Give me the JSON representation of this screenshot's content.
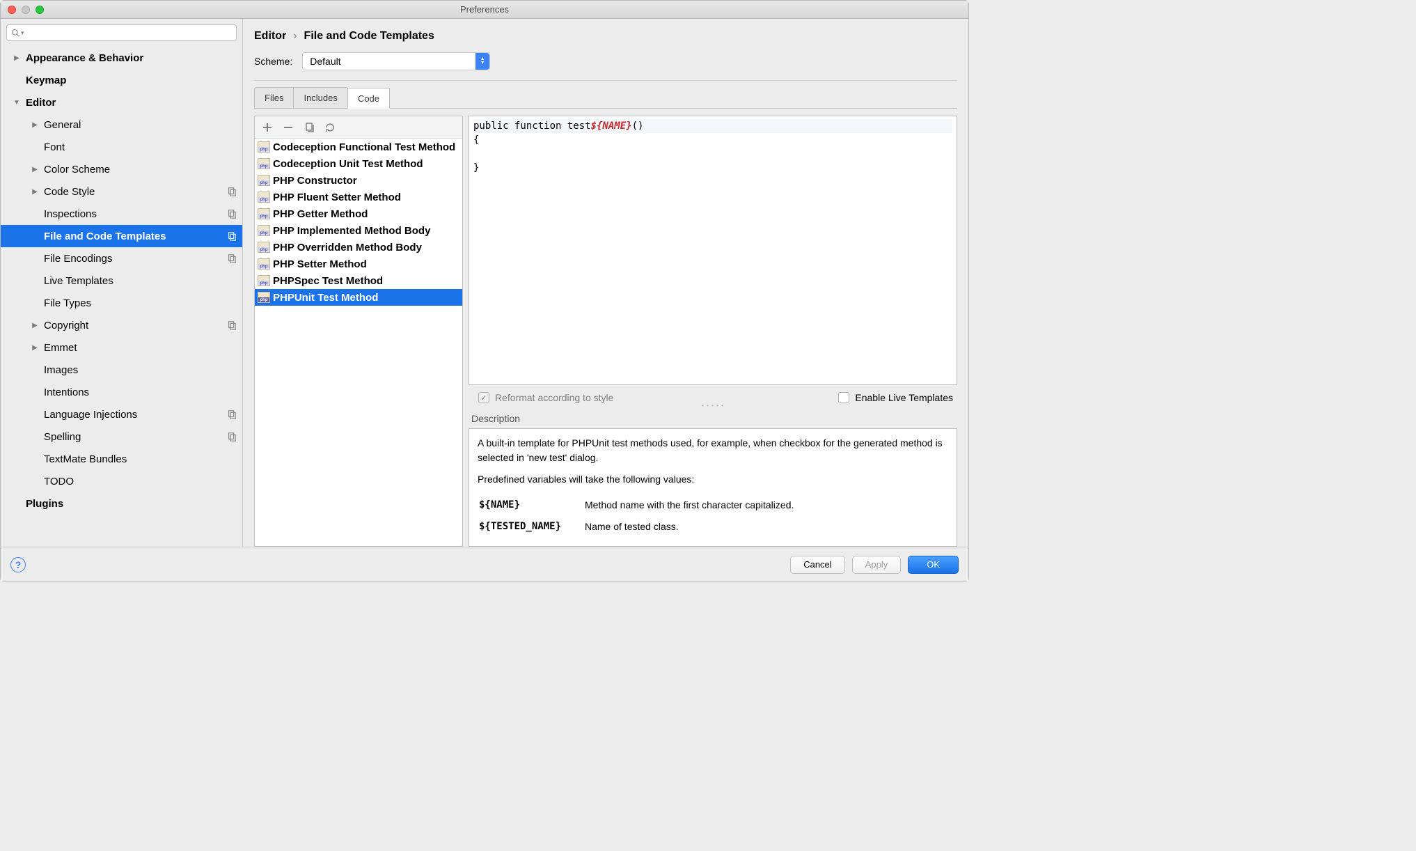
{
  "window": {
    "title": "Preferences"
  },
  "sidebar": {
    "items": [
      {
        "label": "Appearance & Behavior",
        "level": 0,
        "arrow": "right"
      },
      {
        "label": "Keymap",
        "level": 0
      },
      {
        "label": "Editor",
        "level": 0,
        "arrow": "down"
      },
      {
        "label": "General",
        "level": 1,
        "arrow": "right"
      },
      {
        "label": "Font",
        "level": 1
      },
      {
        "label": "Color Scheme",
        "level": 1,
        "arrow": "right"
      },
      {
        "label": "Code Style",
        "level": 1,
        "arrow": "right",
        "copy": true
      },
      {
        "label": "Inspections",
        "level": 1,
        "copy": true
      },
      {
        "label": "File and Code Templates",
        "level": 1,
        "copy": true,
        "selected": true
      },
      {
        "label": "File Encodings",
        "level": 1,
        "copy": true
      },
      {
        "label": "Live Templates",
        "level": 1
      },
      {
        "label": "File Types",
        "level": 1
      },
      {
        "label": "Copyright",
        "level": 1,
        "arrow": "right",
        "copy": true
      },
      {
        "label": "Emmet",
        "level": 1,
        "arrow": "right"
      },
      {
        "label": "Images",
        "level": 1
      },
      {
        "label": "Intentions",
        "level": 1
      },
      {
        "label": "Language Injections",
        "level": 1,
        "copy": true
      },
      {
        "label": "Spelling",
        "level": 1,
        "copy": true
      },
      {
        "label": "TextMate Bundles",
        "level": 1
      },
      {
        "label": "TODO",
        "level": 1
      },
      {
        "label": "Plugins",
        "level": 0
      }
    ]
  },
  "breadcrumb": {
    "part1": "Editor",
    "part2": "File and Code Templates"
  },
  "scheme": {
    "label": "Scheme:",
    "value": "Default"
  },
  "tabs": [
    {
      "label": "Files"
    },
    {
      "label": "Includes"
    },
    {
      "label": "Code",
      "active": true
    }
  ],
  "templates": [
    {
      "label": "Codeception Functional Test Method"
    },
    {
      "label": "Codeception Unit Test Method"
    },
    {
      "label": "PHP Constructor"
    },
    {
      "label": "PHP Fluent Setter Method"
    },
    {
      "label": "PHP Getter Method"
    },
    {
      "label": "PHP Implemented Method Body"
    },
    {
      "label": "PHP Overridden Method Body"
    },
    {
      "label": "PHP Setter Method"
    },
    {
      "label": "PHPSpec Test Method"
    },
    {
      "label": "PHPUnit Test Method",
      "selected": true
    }
  ],
  "editor": {
    "prefix": "public function test",
    "var": "${NAME}",
    "suffix": "()",
    "line2": "{",
    "line3": "",
    "line4": "}"
  },
  "options": {
    "reformat": {
      "label": "Reformat according to style",
      "checked": true,
      "disabled": true
    },
    "liveTpl": {
      "label": "Enable Live Templates",
      "checked": false,
      "disabled": false
    }
  },
  "description": {
    "header": "Description",
    "para1": "A built-in template for PHPUnit test methods used, for example, when checkbox for the generated method is selected in 'new test' dialog.",
    "para2": "Predefined variables will take the following values:",
    "vars": [
      {
        "name": "${NAME}",
        "desc": "Method name with the first character capitalized."
      },
      {
        "name": "${TESTED_NAME}",
        "desc": "Name of tested class."
      }
    ]
  },
  "footer": {
    "cancel": "Cancel",
    "apply": "Apply",
    "ok": "OK"
  }
}
